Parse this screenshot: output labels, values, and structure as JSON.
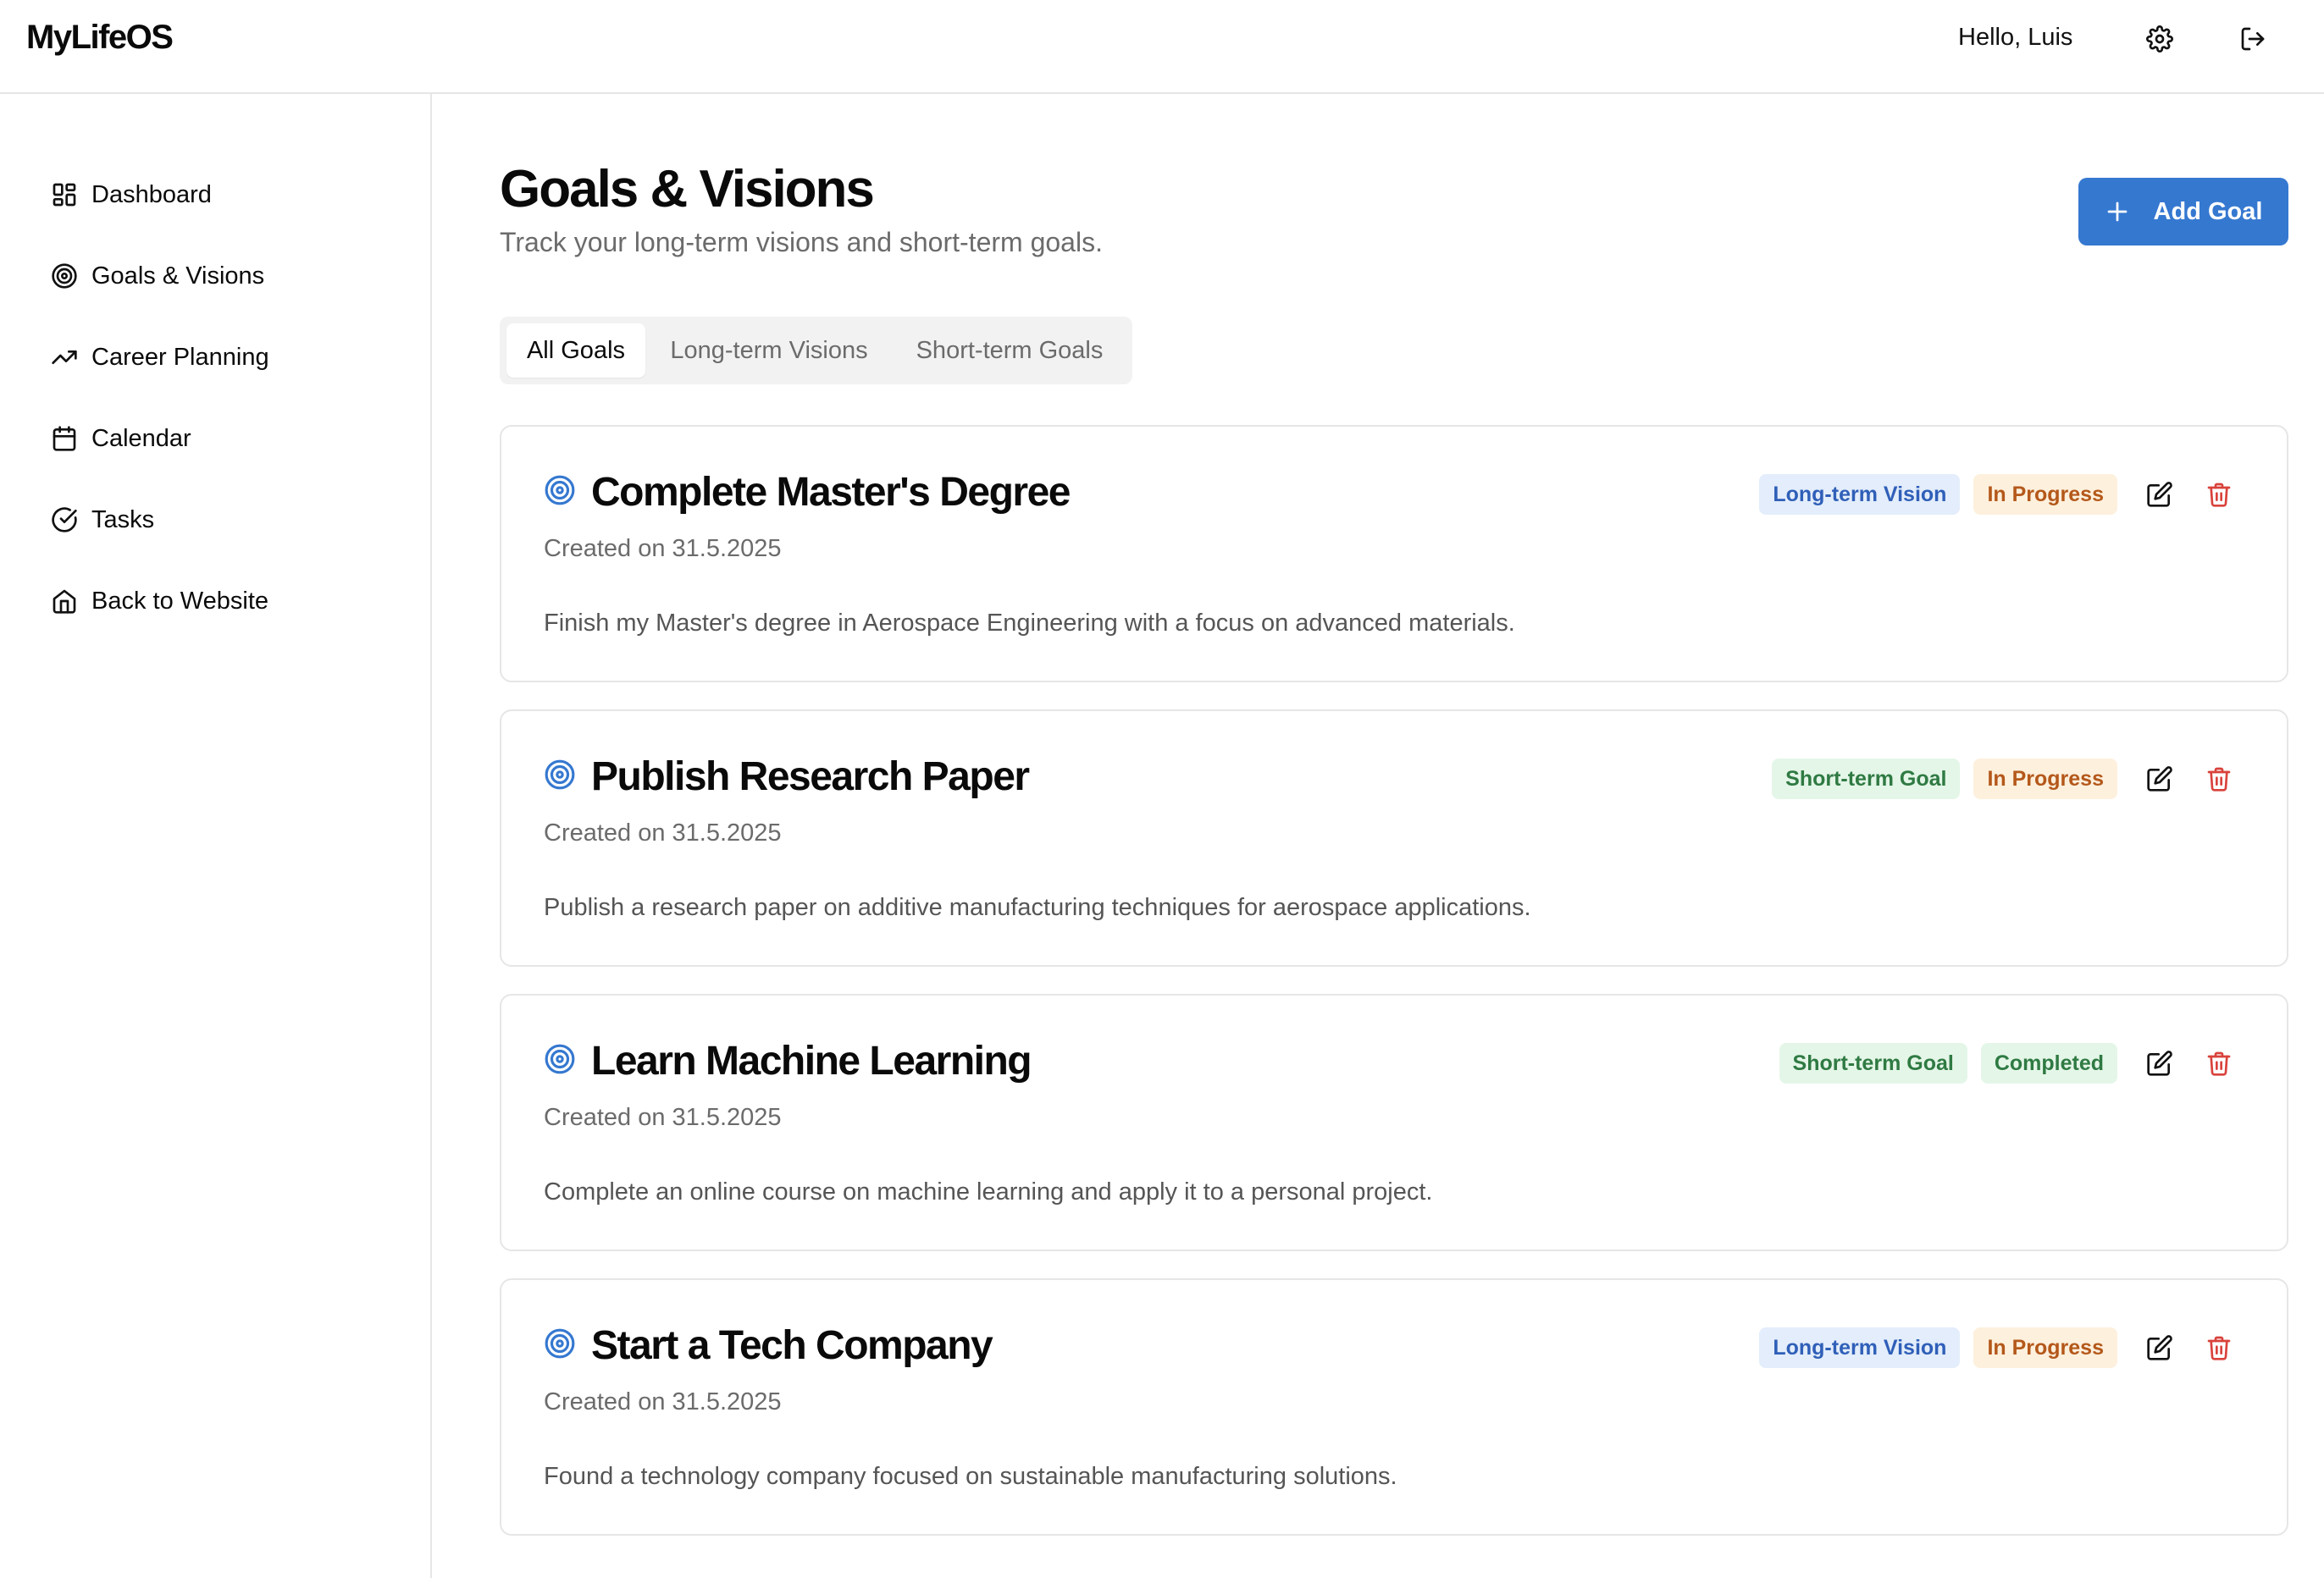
{
  "header": {
    "brand": "MyLifeOS",
    "greeting": "Hello, Luis"
  },
  "sidebar": {
    "items": [
      {
        "label": "Dashboard",
        "icon": "dashboard-icon"
      },
      {
        "label": "Goals & Visions",
        "icon": "target-icon"
      },
      {
        "label": "Career Planning",
        "icon": "trending-up-icon"
      },
      {
        "label": "Calendar",
        "icon": "calendar-icon"
      },
      {
        "label": "Tasks",
        "icon": "check-circle-icon"
      },
      {
        "label": "Back to Website",
        "icon": "home-icon"
      }
    ]
  },
  "main": {
    "title": "Goals & Visions",
    "subtitle": "Track your long-term visions and short-term goals.",
    "add_button": "Add Goal",
    "tabs": [
      {
        "label": "All Goals",
        "active": true
      },
      {
        "label": "Long-term Visions",
        "active": false
      },
      {
        "label": "Short-term Goals",
        "active": false
      }
    ],
    "goals": [
      {
        "title": "Complete Master's Degree",
        "created": "Created on 31.5.2025",
        "description": "Finish my Master's degree in Aerospace Engineering with a focus on advanced materials.",
        "type": "Long-term Vision",
        "status": "In Progress"
      },
      {
        "title": "Publish Research Paper",
        "created": "Created on 31.5.2025",
        "description": "Publish a research paper on additive manufacturing techniques for aerospace applications.",
        "type": "Short-term Goal",
        "status": "In Progress"
      },
      {
        "title": "Learn Machine Learning",
        "created": "Created on 31.5.2025",
        "description": "Complete an online course on machine learning and apply it to a personal project.",
        "type": "Short-term Goal",
        "status": "Completed"
      },
      {
        "title": "Start a Tech Company",
        "created": "Created on 31.5.2025",
        "description": "Found a technology company focused on sustainable manufacturing solutions.",
        "type": "Long-term Vision",
        "status": "In Progress"
      }
    ]
  },
  "colors": {
    "accent": "#3578d0",
    "delete": "#d9423b",
    "long_badge_bg": "#e3edfb",
    "short_badge_bg": "#e4f6e8",
    "progress_badge_bg": "#fdf0dd"
  }
}
